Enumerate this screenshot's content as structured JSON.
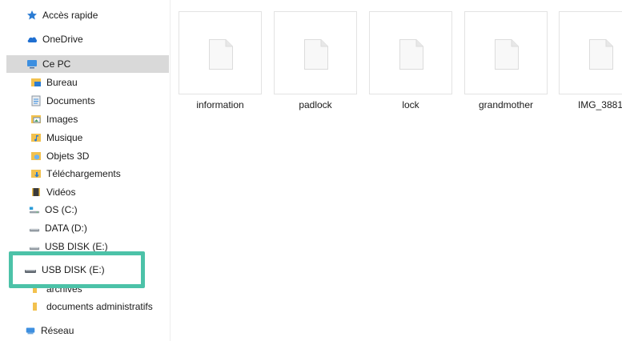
{
  "sidebar": {
    "items": [
      {
        "label": "Accès rapide",
        "icon": "star-icon"
      },
      {
        "label": "OneDrive",
        "icon": "cloud-icon"
      },
      {
        "label": "Ce PC",
        "icon": "pc-icon"
      },
      {
        "label": "Bureau",
        "icon": "desktop-folder-icon"
      },
      {
        "label": "Documents",
        "icon": "documents-folder-icon"
      },
      {
        "label": "Images",
        "icon": "images-folder-icon"
      },
      {
        "label": "Musique",
        "icon": "music-folder-icon"
      },
      {
        "label": "Objets 3D",
        "icon": "objects-3d-folder-icon"
      },
      {
        "label": "Téléchargements",
        "icon": "downloads-folder-icon"
      },
      {
        "label": "Vidéos",
        "icon": "videos-folder-icon"
      },
      {
        "label": "OS (C:)",
        "icon": "windows-drive-icon"
      },
      {
        "label": "DATA (D:)",
        "icon": "drive-icon"
      },
      {
        "label": "USB DISK (E:)",
        "icon": "usb-drive-icon"
      },
      {
        "label": "archives",
        "icon": "folder-icon"
      },
      {
        "label": "documents administratifs",
        "icon": "folder-icon"
      },
      {
        "label": "Réseau",
        "icon": "network-icon"
      }
    ],
    "selected": "Ce PC"
  },
  "highlight": {
    "label": "USB DISK (E:)",
    "icon": "usb-drive-icon",
    "color": "#4cc2a8"
  },
  "files": [
    {
      "name": "information",
      "icon": "file-icon"
    },
    {
      "name": "padlock",
      "icon": "file-icon"
    },
    {
      "name": "lock",
      "icon": "file-icon"
    },
    {
      "name": "grandmother",
      "icon": "file-icon"
    },
    {
      "name": "IMG_3881",
      "icon": "file-icon"
    }
  ]
}
